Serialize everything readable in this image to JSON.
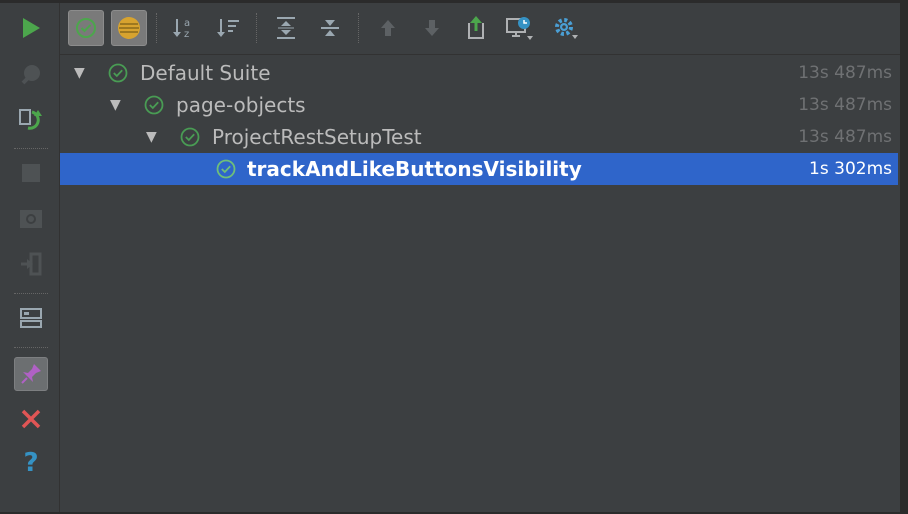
{
  "top_toolbar": {
    "buttons": [
      {
        "icon": "show-passed-icon",
        "toggled": true
      },
      {
        "icon": "show-ignored-icon",
        "toggled": true
      },
      {
        "icon": "sort-alphabetically-icon"
      },
      {
        "icon": "sort-by-duration-icon"
      },
      {
        "icon": "expand-all-icon"
      },
      {
        "icon": "collapse-all-icon"
      },
      {
        "icon": "previous-failed-icon"
      },
      {
        "icon": "next-failed-icon"
      },
      {
        "icon": "export-results-icon"
      },
      {
        "icon": "test-history-icon"
      },
      {
        "icon": "settings-icon"
      }
    ]
  },
  "side_toolbar": {
    "buttons": [
      {
        "icon": "run-icon"
      },
      {
        "icon": "debug-icon"
      },
      {
        "icon": "rerun-failed-icon"
      },
      {
        "icon": "stop-icon"
      },
      {
        "icon": "screenshot-icon"
      },
      {
        "icon": "import-tests-icon"
      },
      {
        "icon": "layout-icon"
      },
      {
        "icon": "pin-tab-icon",
        "toggled": true
      },
      {
        "icon": "close-icon"
      },
      {
        "icon": "help-icon"
      }
    ]
  },
  "tree": {
    "rows": [
      {
        "label": "Default Suite",
        "duration": "13s 487ms",
        "expanded": true,
        "selected": false
      },
      {
        "label": "page-objects",
        "duration": "13s 487ms",
        "expanded": true,
        "selected": false
      },
      {
        "label": "ProjectRestSetupTest",
        "duration": "13s 487ms",
        "expanded": true,
        "selected": false
      },
      {
        "label": "trackAndLikeButtonsVisibility",
        "duration": "1s 302ms",
        "expanded": false,
        "selected": true
      }
    ],
    "expand_glyph": "▼"
  },
  "help_glyph": "?",
  "colors": {
    "background": "#3c3f41",
    "selection": "#2f65ca",
    "passed": "#499c54",
    "run": "#4ca64c",
    "close": "#e05555",
    "help": "#3592c4"
  }
}
